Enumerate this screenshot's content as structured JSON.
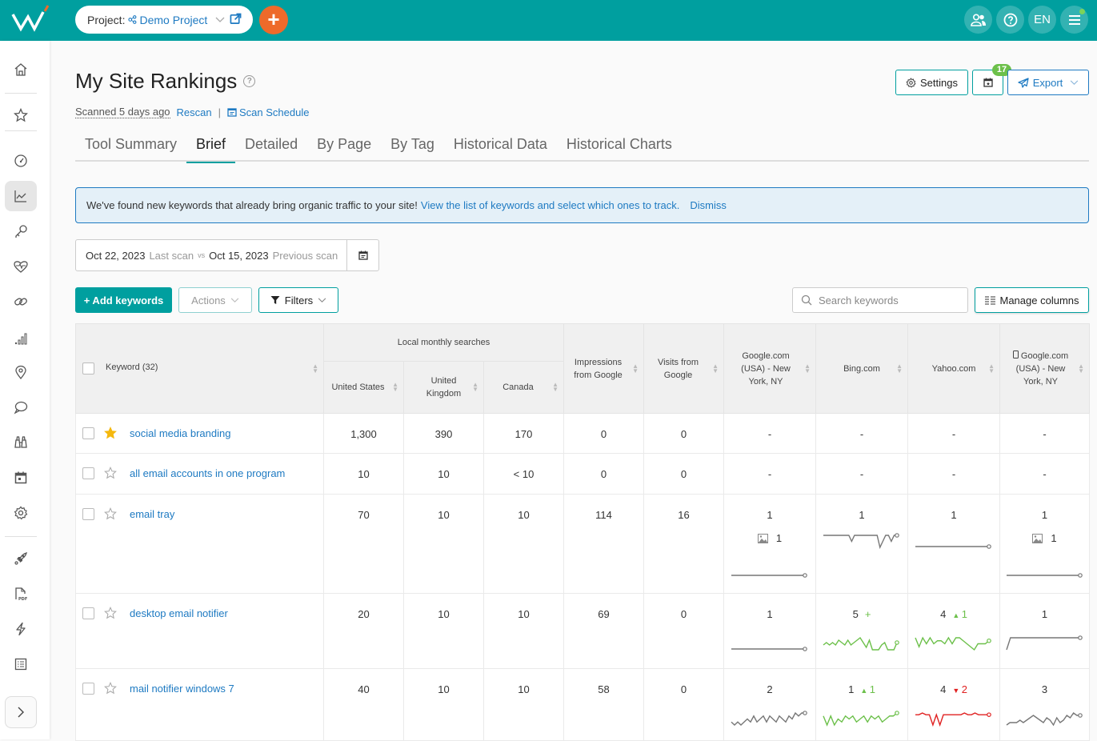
{
  "topbar": {
    "project_label": "Project:",
    "project_name": "Demo Project",
    "add_icon": "plus-icon",
    "users_icon": "users-icon",
    "help_icon": "question-icon",
    "lang": "EN",
    "menu_icon": "hamburger-icon"
  },
  "sidebar": {
    "items": [
      "home",
      "favorites",
      "dashboard",
      "rankings",
      "keywords",
      "site-health",
      "backlinks",
      "traffic",
      "local-seo",
      "social",
      "competitors",
      "calendar",
      "settings",
      "launch",
      "pdf-report",
      "automation",
      "task-list"
    ]
  },
  "page": {
    "title": "My Site Rankings",
    "scanned": "Scanned 5 days ago",
    "rescan": "Rescan",
    "separator": "|",
    "scan_schedule": "Scan Schedule",
    "settings_label": "Settings",
    "calendar_badge": "17",
    "export_label": "Export"
  },
  "tabs": [
    {
      "label": "Tool Summary",
      "active": false
    },
    {
      "label": "Brief",
      "active": true
    },
    {
      "label": "Detailed",
      "active": false
    },
    {
      "label": "By Page",
      "active": false
    },
    {
      "label": "By Tag",
      "active": false
    },
    {
      "label": "Historical Data",
      "active": false
    },
    {
      "label": "Historical Charts",
      "active": false
    }
  ],
  "banner": {
    "text": "We've found new keywords that already bring organic traffic to your site!",
    "link": "View the list of keywords and select which ones to track.",
    "dismiss": "Dismiss"
  },
  "dates": {
    "last_date": "Oct 22, 2023",
    "last_label": "Last scan",
    "vs": "vs",
    "prev_date": "Oct 15, 2023",
    "prev_label": "Previous scan"
  },
  "toolbar": {
    "add_keywords": "+ Add keywords",
    "actions": "Actions",
    "filters": "Filters",
    "search_placeholder": "Search keywords",
    "manage_columns": "Manage columns"
  },
  "table": {
    "keyword_header": "Keyword (32)",
    "group_header": "Local monthly searches",
    "headers": {
      "us": "United States",
      "uk": "United Kingdom",
      "ca": "Canada",
      "impr": "Impressions from Google",
      "visits": "Visits from Google",
      "google": "Google.com (USA) - New York, NY",
      "bing": "Bing.com",
      "yahoo": "Yahoo.com",
      "google_mobile": "Google.com (USA) - New York, NY"
    },
    "rows": [
      {
        "keyword": "social media branding",
        "starred": true,
        "us": "1,300",
        "uk": "390",
        "ca": "170",
        "impr": "0",
        "visits": "0",
        "google": {
          "rank": "-"
        },
        "bing": {
          "rank": "-"
        },
        "yahoo": {
          "rank": "-"
        },
        "gmobile": {
          "rank": "-"
        }
      },
      {
        "keyword": "all email accounts in one program",
        "starred": false,
        "us": "10",
        "uk": "10",
        "ca": "< 10",
        "impr": "0",
        "visits": "0",
        "google": {
          "rank": "-"
        },
        "bing": {
          "rank": "-"
        },
        "yahoo": {
          "rank": "-"
        },
        "gmobile": {
          "rank": "-"
        }
      },
      {
        "keyword": "email tray",
        "starred": false,
        "us": "70",
        "uk": "10",
        "ca": "10",
        "impr": "114",
        "visits": "16",
        "google": {
          "rank": "1",
          "image_rank": "1",
          "trend": [
            1,
            1,
            1,
            1,
            1,
            1,
            1,
            1,
            1,
            1,
            1,
            1,
            1,
            1,
            1,
            1,
            1,
            1,
            1,
            1
          ],
          "color": "gray"
        },
        "bing": {
          "rank": "1",
          "trend": [
            1,
            1,
            1,
            1,
            1,
            1,
            1,
            1,
            1,
            1,
            2,
            1,
            1,
            1,
            1,
            1,
            1,
            1,
            1,
            1,
            3,
            2,
            1,
            1,
            2,
            1,
            1
          ],
          "color": "gray"
        },
        "yahoo": {
          "rank": "1",
          "trend": [
            1,
            1,
            1,
            1,
            1,
            1,
            1,
            1,
            1,
            1,
            1,
            1,
            1,
            1,
            1,
            1,
            1,
            1,
            1,
            1
          ],
          "color": "gray"
        },
        "gmobile": {
          "rank": "1",
          "image_rank": "1",
          "trend": [
            1,
            1,
            1,
            1,
            1,
            1,
            1,
            1,
            1,
            1,
            1,
            1,
            1,
            1,
            1,
            1,
            1,
            1,
            1,
            1
          ],
          "color": "gray"
        }
      },
      {
        "keyword": "desktop email notifier",
        "starred": false,
        "us": "20",
        "uk": "10",
        "ca": "10",
        "impr": "69",
        "visits": "0",
        "google": {
          "rank": "1",
          "trend": [
            1,
            1,
            1,
            1,
            1,
            1,
            1,
            1,
            1,
            1,
            1,
            1,
            1,
            1,
            1,
            1,
            1,
            1,
            1,
            1
          ],
          "color": "gray"
        },
        "bing": {
          "rank": "5",
          "change": "+",
          "change_dir": "new",
          "trend": [
            6,
            5,
            6,
            5,
            6,
            4,
            5,
            6,
            4,
            6,
            5,
            4,
            3,
            5,
            7,
            4,
            8,
            8,
            8,
            6,
            5,
            8,
            8,
            8,
            5
          ],
          "color": "green"
        },
        "yahoo": {
          "rank": "4",
          "change": "1",
          "change_dir": "up",
          "trend": [
            4,
            7,
            4,
            6,
            4,
            6,
            5,
            5,
            6,
            4,
            6,
            4,
            4,
            5,
            6,
            7,
            8,
            6,
            6,
            6,
            5
          ],
          "color": "green"
        },
        "gmobile": {
          "rank": "1",
          "trend": [
            3,
            1,
            1,
            1,
            1,
            1,
            1,
            1,
            1,
            1,
            1,
            1,
            1,
            1,
            1,
            1,
            1,
            1,
            1,
            1
          ],
          "color": "gray"
        }
      },
      {
        "keyword": "mail notifier windows 7",
        "starred": false,
        "us": "40",
        "uk": "10",
        "ca": "10",
        "impr": "58",
        "visits": "0",
        "google": {
          "rank": "2",
          "trend": [
            5,
            6,
            5,
            6,
            5,
            4,
            5,
            3,
            5,
            4,
            3,
            5,
            3,
            4,
            5,
            3,
            4,
            5,
            3,
            4,
            2,
            3,
            2,
            2
          ],
          "color": "gray"
        },
        "bing": {
          "rank": "1",
          "change": "1",
          "change_dir": "up",
          "trend": [
            2,
            5,
            2,
            5,
            3,
            4,
            2,
            3,
            2,
            4,
            3,
            2,
            4,
            2,
            3,
            2,
            4,
            3,
            2,
            2,
            1
          ],
          "color": "green"
        },
        "yahoo": {
          "rank": "4",
          "change": "2",
          "change_dir": "down",
          "trend": [
            2,
            2,
            1,
            2,
            2,
            8,
            2,
            8,
            2,
            2,
            2,
            2,
            2,
            2,
            1,
            2,
            2,
            1,
            2,
            2,
            2,
            2
          ],
          "color": "red"
        },
        "gmobile": {
          "rank": "3",
          "trend": [
            7,
            6,
            6,
            6,
            5,
            6,
            5,
            4,
            3,
            4,
            5,
            6,
            4,
            5,
            7,
            4,
            6,
            5,
            3,
            4,
            2,
            3,
            3
          ],
          "color": "gray"
        }
      }
    ]
  }
}
